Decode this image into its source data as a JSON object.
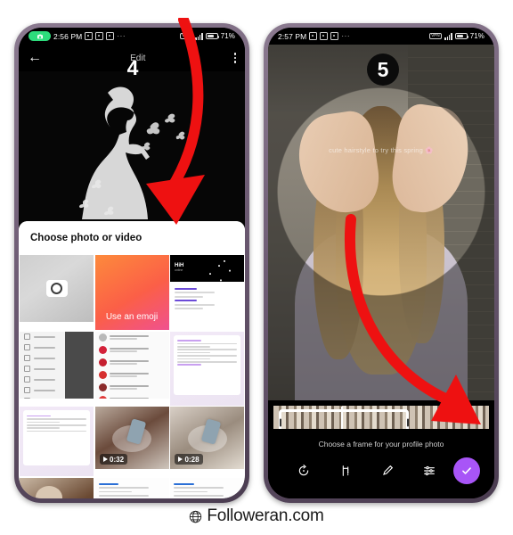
{
  "footer": {
    "brand": "Followeran.com",
    "globe_icon": "globe-icon"
  },
  "phones": [
    {
      "id": "phone-step-4",
      "step_badge": "4",
      "status_bar": {
        "camera_indicator": "camera-active-icon",
        "time": "2:56 PM",
        "app_icons": [
          "app-icon",
          "app-icon",
          "app-icon"
        ],
        "overflow": "···",
        "vpn": "VPN",
        "signal": "signal-icon",
        "battery_icon": "battery-icon",
        "battery_pct": "71%"
      },
      "app_bar": {
        "back_icon": "back-arrow-icon",
        "title": "Edit",
        "menu_icon": "kebab-menu-icon"
      },
      "hero": {
        "alt": "woman-silhouette-with-butterflies"
      },
      "sheet": {
        "title": "Choose photo or video",
        "tiles": [
          {
            "name": "camera-tile",
            "label": "",
            "kind": "camera"
          },
          {
            "name": "use-emoji-tile",
            "label": "Use an emoji",
            "kind": "emoji"
          },
          {
            "name": "gallery-thumb-screenshot",
            "label": "",
            "kind": "screenshot",
            "heading": "HiH",
            "sub": "online"
          },
          {
            "name": "gallery-thumb-telegram-menu",
            "label": "",
            "kind": "menu"
          },
          {
            "name": "gallery-thumb-chatlist",
            "label": "",
            "kind": "chats"
          },
          {
            "name": "gallery-thumb-message",
            "label": "",
            "kind": "message"
          },
          {
            "name": "gallery-thumb-message-2",
            "label": "",
            "kind": "message"
          },
          {
            "name": "gallery-video-1",
            "label": "0:32",
            "kind": "video"
          },
          {
            "name": "gallery-video-2",
            "label": "0:28",
            "kind": "video"
          },
          {
            "name": "gallery-thumb-coffee",
            "label": "",
            "kind": "coffee"
          },
          {
            "name": "gallery-thumb-post-1",
            "label": "",
            "kind": "post"
          },
          {
            "name": "gallery-thumb-post-2",
            "label": "",
            "kind": "post"
          }
        ]
      }
    },
    {
      "id": "phone-step-5",
      "step_badge": "5",
      "status_bar": {
        "time": "2:57 PM",
        "app_icons": [
          "app-icon",
          "app-icon",
          "app-icon"
        ],
        "overflow": "···",
        "vpn": "VPN",
        "signal": "signal-icon",
        "battery_icon": "battery-icon",
        "battery_pct": "71%"
      },
      "media": {
        "caption": "cute hairstyle to try this spring 🌸",
        "alt": "back-of-woman-braiding-long-blonde-hair"
      },
      "editor": {
        "frame_hint": "Choose a frame for your profile photo",
        "tools": [
          {
            "name": "rotate-icon",
            "label": "Rotate"
          },
          {
            "name": "crop-icon",
            "label": "Crop"
          },
          {
            "name": "draw-icon",
            "label": "Draw"
          },
          {
            "name": "adjust-icon",
            "label": "Adjust"
          }
        ],
        "confirm": {
          "name": "check-icon",
          "label": "Done",
          "color": "#a855f7"
        }
      }
    }
  ],
  "annotations": [
    {
      "name": "red-arrow-step-4",
      "points_to": "Choose photo or video sheet"
    },
    {
      "name": "red-arrow-step-5",
      "points_to": "video filmstrip frame selector"
    }
  ],
  "colors": {
    "phone_frame": "#6e5c74",
    "accent_purple": "#a855f7",
    "arrow_red": "#ee1111",
    "camera_pill_green": "#2ddc7c"
  }
}
